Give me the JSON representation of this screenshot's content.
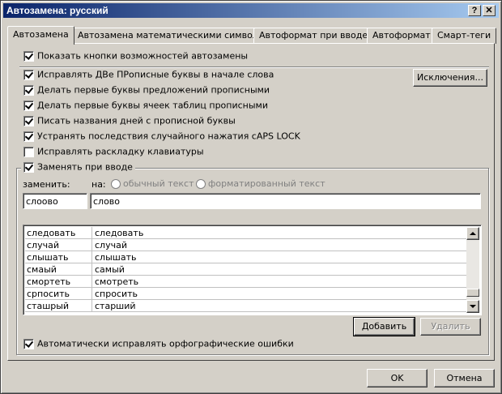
{
  "window": {
    "title": "Автозамена: русский",
    "help_btn": "?",
    "close_btn": "✕"
  },
  "tabs": [
    {
      "label": "Автозамена"
    },
    {
      "label": "Автозамена математическими символами"
    },
    {
      "label": "Автоформат при вводе"
    },
    {
      "label": "Автоформат"
    },
    {
      "label": "Смарт-теги"
    }
  ],
  "options": {
    "show_buttons": "Показать кнопки возможностей автозамены",
    "two_caps": "Исправлять ДВе ПРописные буквы в начале слова",
    "first_sentence": "Делать первые буквы предложений прописными",
    "first_table": "Делать первые буквы ячеек таблиц прописными",
    "day_names": "Писать названия дней с прописной буквы",
    "caps_lock": "Устранять последствия случайного нажатия cAPS LOCK",
    "keyboard": "Исправлять раскладку клавиатуры",
    "replace_as_type": "Заменять при вводе",
    "auto_spell": "Автоматически исправлять орфографические ошибки"
  },
  "buttons": {
    "exceptions": "Исключения...",
    "add": "Добавить",
    "delete": "Удалить",
    "ok": "OK",
    "cancel": "Отмена"
  },
  "replace": {
    "replace_label": "заменить:",
    "with_label": "на:",
    "plain_text": "обычный текст",
    "formatted_text": "форматированный текст",
    "replace_value": "слоово",
    "with_value": "слово"
  },
  "list_rows": [
    {
      "from": "следовать",
      "to": "следовать"
    },
    {
      "from": "случай",
      "to": "случай"
    },
    {
      "from": "слышать",
      "to": "слышать"
    },
    {
      "from": "смаый",
      "to": "самый"
    },
    {
      "from": "смортеть",
      "to": "смотреть"
    },
    {
      "from": "српосить",
      "to": "спросить"
    },
    {
      "from": "сташрый",
      "to": "старший"
    }
  ]
}
